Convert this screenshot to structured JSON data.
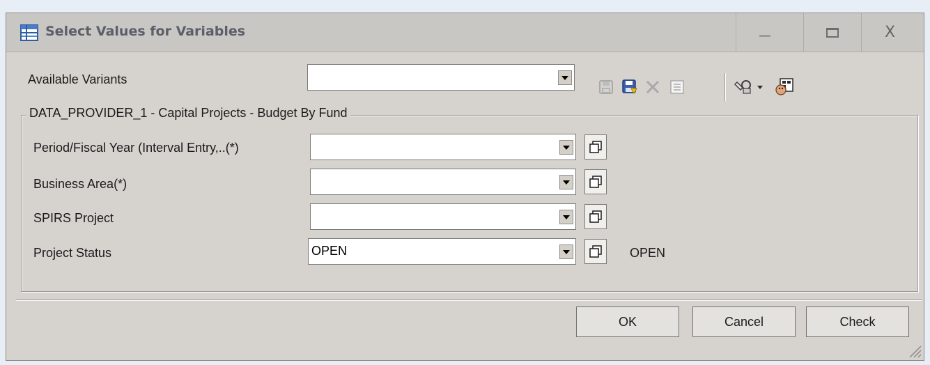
{
  "window": {
    "title": "Select Values for Variables",
    "close_glyph": "X"
  },
  "variants": {
    "label": "Available Variants",
    "value": ""
  },
  "toolbar": {
    "icons": [
      "save-icon",
      "save-as-icon",
      "delete-icon",
      "details-icon",
      "tools-icon",
      "dropdown-arrow-icon",
      "personalize-icon"
    ]
  },
  "group": {
    "title": "DATA_PROVIDER_1 - Capital Projects - Budget By Fund",
    "rows": [
      {
        "label": "Period/Fiscal Year (Interval Entry,..(*)",
        "value": "",
        "description": ""
      },
      {
        "label": "Business Area(*)",
        "value": "",
        "description": ""
      },
      {
        "label": "SPIRS Project",
        "value": "",
        "description": ""
      },
      {
        "label": "Project Status",
        "value": "OPEN",
        "description": "OPEN"
      }
    ]
  },
  "buttons": {
    "ok": "OK",
    "cancel": "Cancel",
    "check": "Check"
  },
  "colors": {
    "dialog_bg": "#d6d3ce",
    "titlebar_bg": "#c9c7c4",
    "title_text": "#5b6068"
  }
}
